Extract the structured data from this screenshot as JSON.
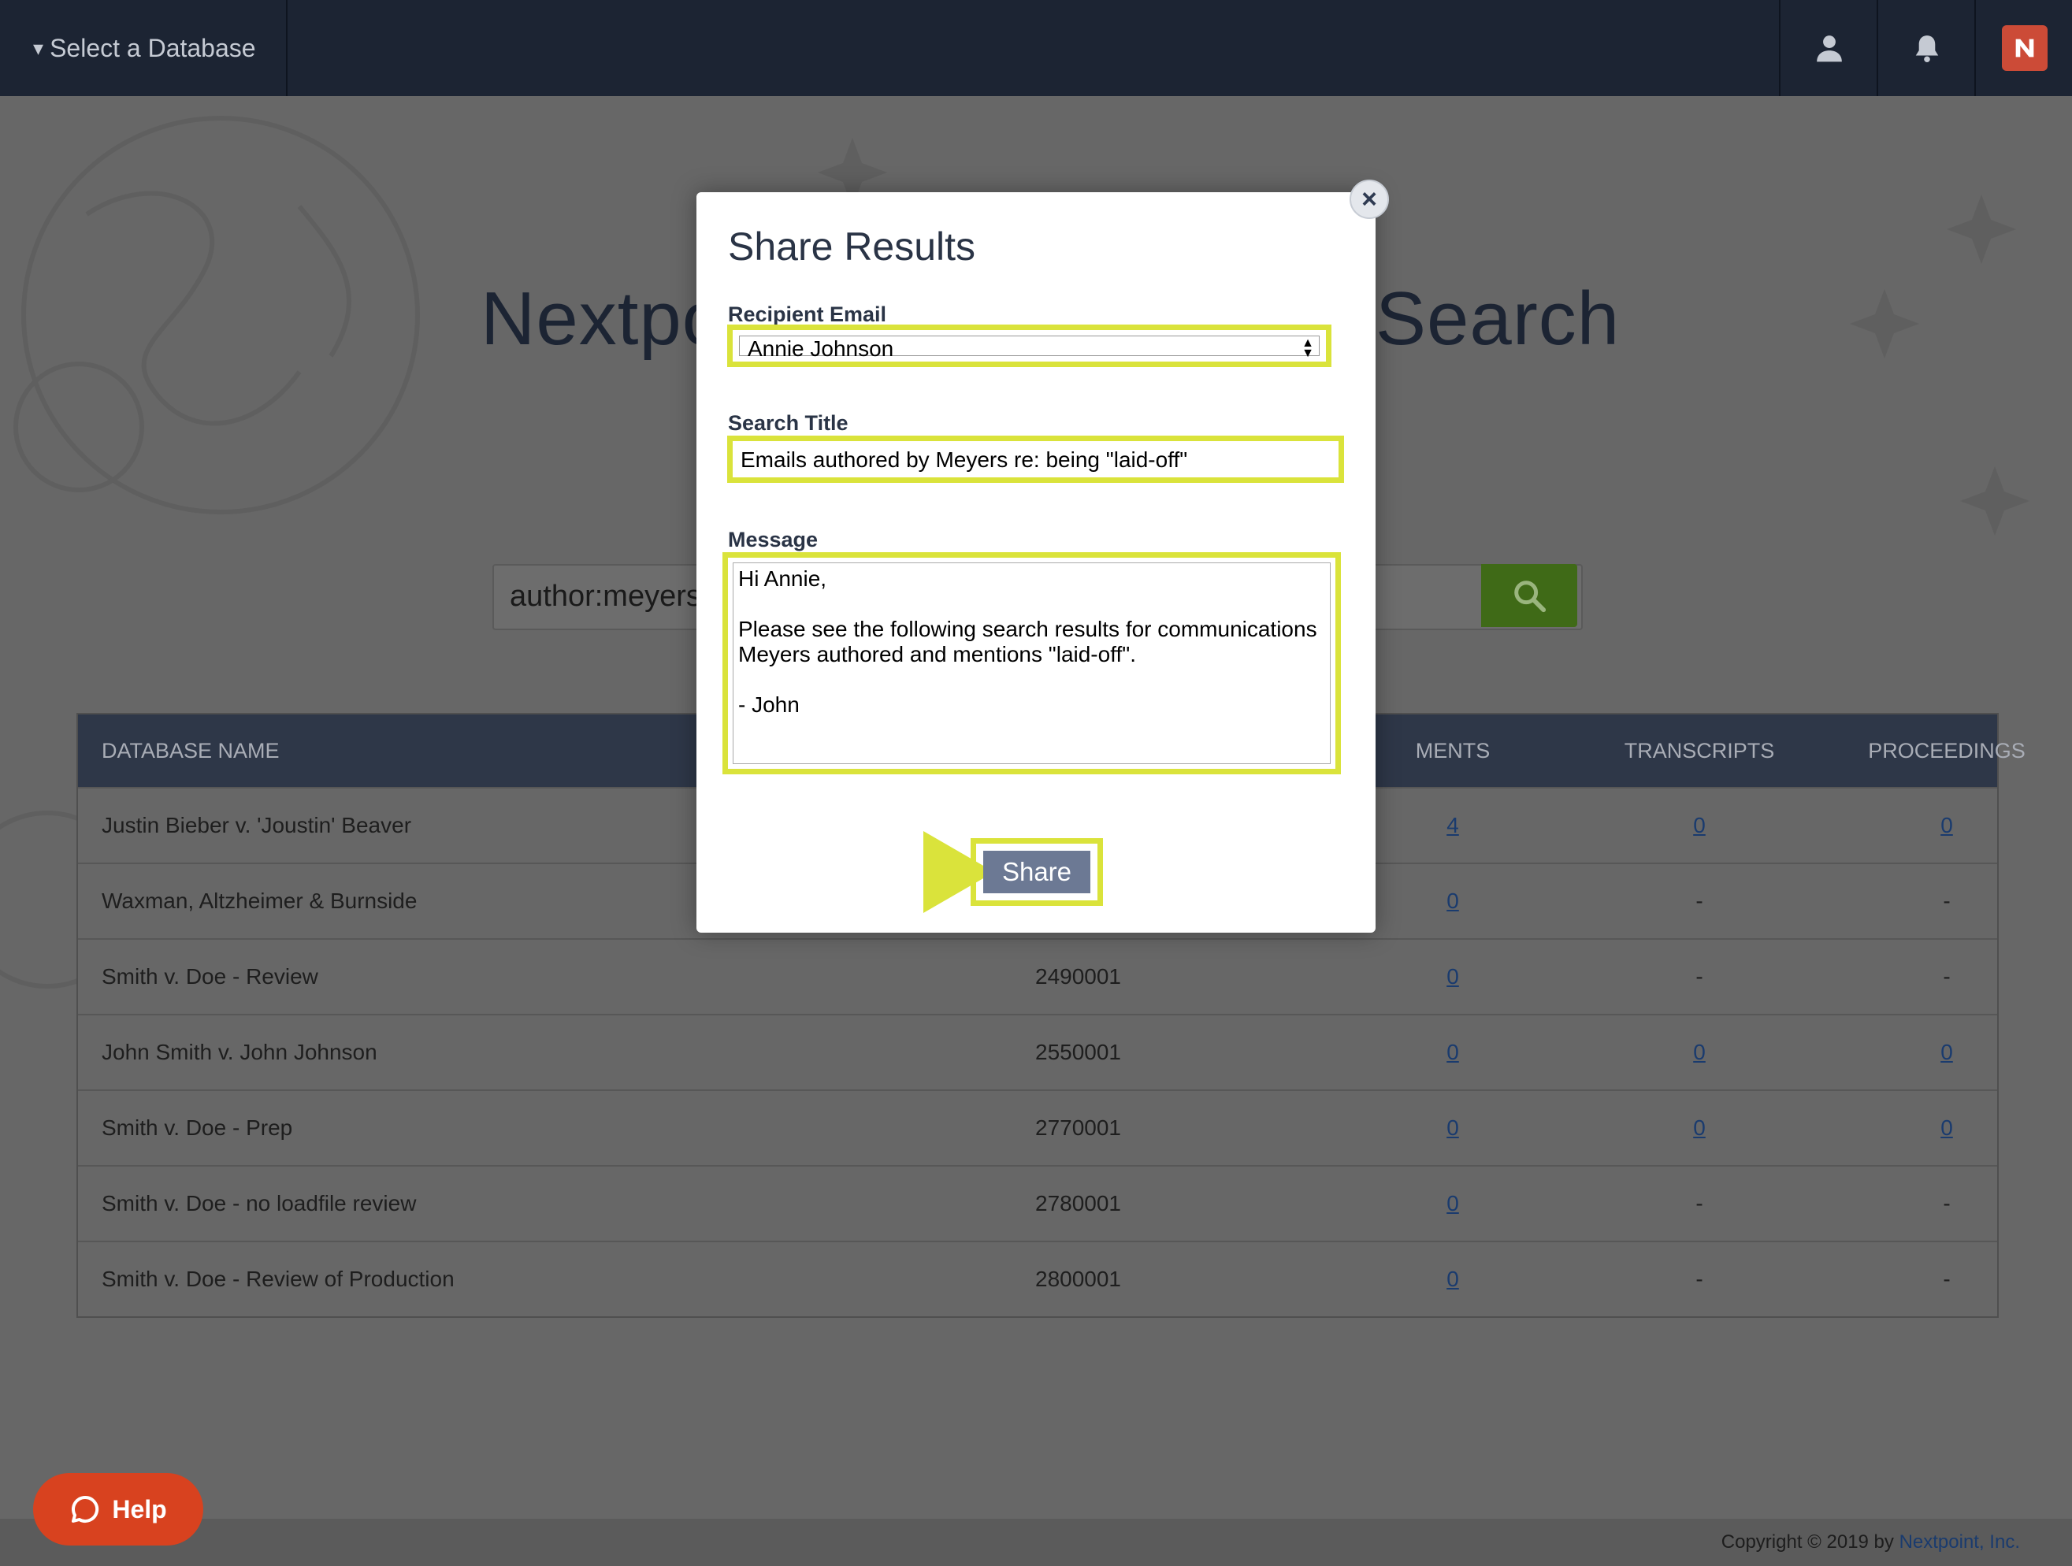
{
  "topbar": {
    "db_select_label": "Select a Database",
    "caret": "▾",
    "icons": [
      "user-icon",
      "bell-icon",
      "nextpoint-logo-icon"
    ]
  },
  "hero": {
    "title_left": "Nextpo",
    "title_right": "Search"
  },
  "search": {
    "query": "author:meyers"
  },
  "table": {
    "headers": {
      "name": "DATABASE NAME",
      "documents": "MENTS",
      "transcripts": "TRANSCRIPTS",
      "proceedings": "PROCEEDINGS"
    },
    "rows": [
      {
        "name": "Justin Bieber v. 'Joustin' Beaver",
        "id": "",
        "documents": "4",
        "transcripts": "0",
        "proceedings": "0"
      },
      {
        "name": "Waxman, Altzheimer & Burnside",
        "id": "",
        "documents": "0",
        "transcripts": "-",
        "proceedings": "-"
      },
      {
        "name": "Smith v. Doe - Review",
        "id": "2490001",
        "documents": "0",
        "transcripts": "-",
        "proceedings": "-"
      },
      {
        "name": "John Smith v. John Johnson",
        "id": "2550001",
        "documents": "0",
        "transcripts": "0",
        "proceedings": "0"
      },
      {
        "name": "Smith v. Doe - Prep",
        "id": "2770001",
        "documents": "0",
        "transcripts": "0",
        "proceedings": "0"
      },
      {
        "name": "Smith v. Doe - no loadfile review",
        "id": "2780001",
        "documents": "0",
        "transcripts": "-",
        "proceedings": "-"
      },
      {
        "name": "Smith v. Doe - Review of Production",
        "id": "2800001",
        "documents": "0",
        "transcripts": "-",
        "proceedings": "-"
      }
    ]
  },
  "modal": {
    "title": "Share Results",
    "close_symbol": "×",
    "recipient_label": "Recipient Email",
    "recipient_value": "Annie Johnson",
    "search_title_label": "Search Title",
    "search_title_value": "Emails authored by Meyers re: being \"laid-off\"",
    "message_label": "Message",
    "message_value": "Hi Annie,\n\nPlease see the following search results for communications Meyers authored and mentions \"laid-off\".\n\n- John",
    "share_label": "Share"
  },
  "help": {
    "label": "Help"
  },
  "footer": {
    "copyright": "Copyright © 2019 by ",
    "company": "Nextpoint, Inc."
  },
  "colors": {
    "topbar": "#1c2433",
    "overlay_bg": "#676767",
    "highlight": "#dae33b",
    "share_button": "#6c7994",
    "search_button": "#3f6a17",
    "help_button": "#d8421f"
  }
}
